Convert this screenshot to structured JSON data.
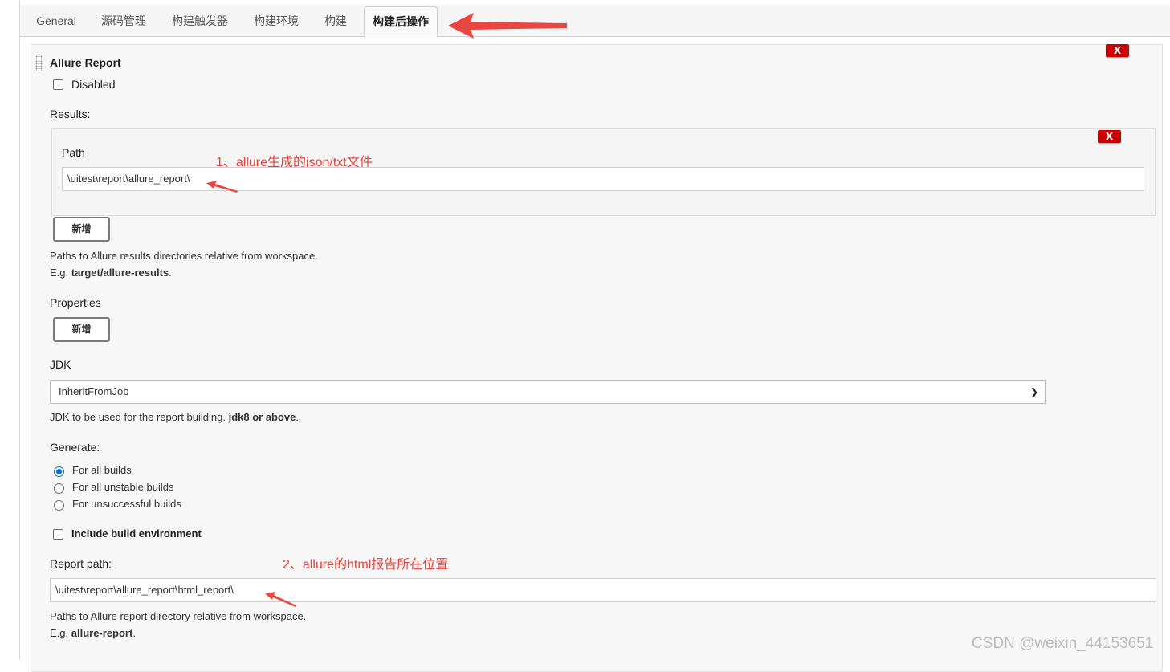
{
  "tabs": [
    {
      "label": "General",
      "active": false
    },
    {
      "label": "源码管理",
      "active": false
    },
    {
      "label": "构建触发器",
      "active": false
    },
    {
      "label": "构建环境",
      "active": false
    },
    {
      "label": "构建",
      "active": false
    },
    {
      "label": "构建后操作",
      "active": true
    }
  ],
  "section": {
    "title": "Allure Report",
    "delete_label": "X",
    "disabled_label": "Disabled",
    "disabled_checked": false
  },
  "results": {
    "label": "Results:",
    "path_label": "Path",
    "path_value": "\\uitest\\report\\allure_report\\",
    "delete_label": "X",
    "add_label": "新增",
    "help_line1": "Paths to Allure results directories relative from workspace.",
    "help_eg_prefix": "E.g. ",
    "help_eg_value": "target/allure-results",
    "help_eg_suffix": "."
  },
  "properties": {
    "label": "Properties",
    "add_label": "新增"
  },
  "jdk": {
    "label": "JDK",
    "selected": "InheritFromJob",
    "help_prefix": "JDK to be used for the report building. ",
    "help_bold": "jdk8 or above",
    "help_suffix": "."
  },
  "generate": {
    "label": "Generate:",
    "options": [
      {
        "label": "For all builds",
        "checked": true
      },
      {
        "label": "For all unstable builds",
        "checked": false
      },
      {
        "label": "For unsuccessful builds",
        "checked": false
      }
    ]
  },
  "include_env": {
    "label": "Include build environment",
    "checked": false
  },
  "report_path": {
    "label": "Report path:",
    "value": "\\uitest\\report\\allure_report\\html_report\\",
    "help_line1": "Paths to Allure report directory relative from workspace.",
    "help_eg_prefix": "E.g. ",
    "help_eg_value": "allure-report",
    "help_eg_suffix": "."
  },
  "annotations": {
    "note1": "1、allure生成的json/txt文件",
    "note2": "2、allure的html报告所在位置",
    "color": "#e8413b"
  },
  "watermark": "CSDN @weixin_44153651",
  "colors": {
    "delete_button": "#cc0000",
    "radio_selected": "#0a6ed1"
  }
}
